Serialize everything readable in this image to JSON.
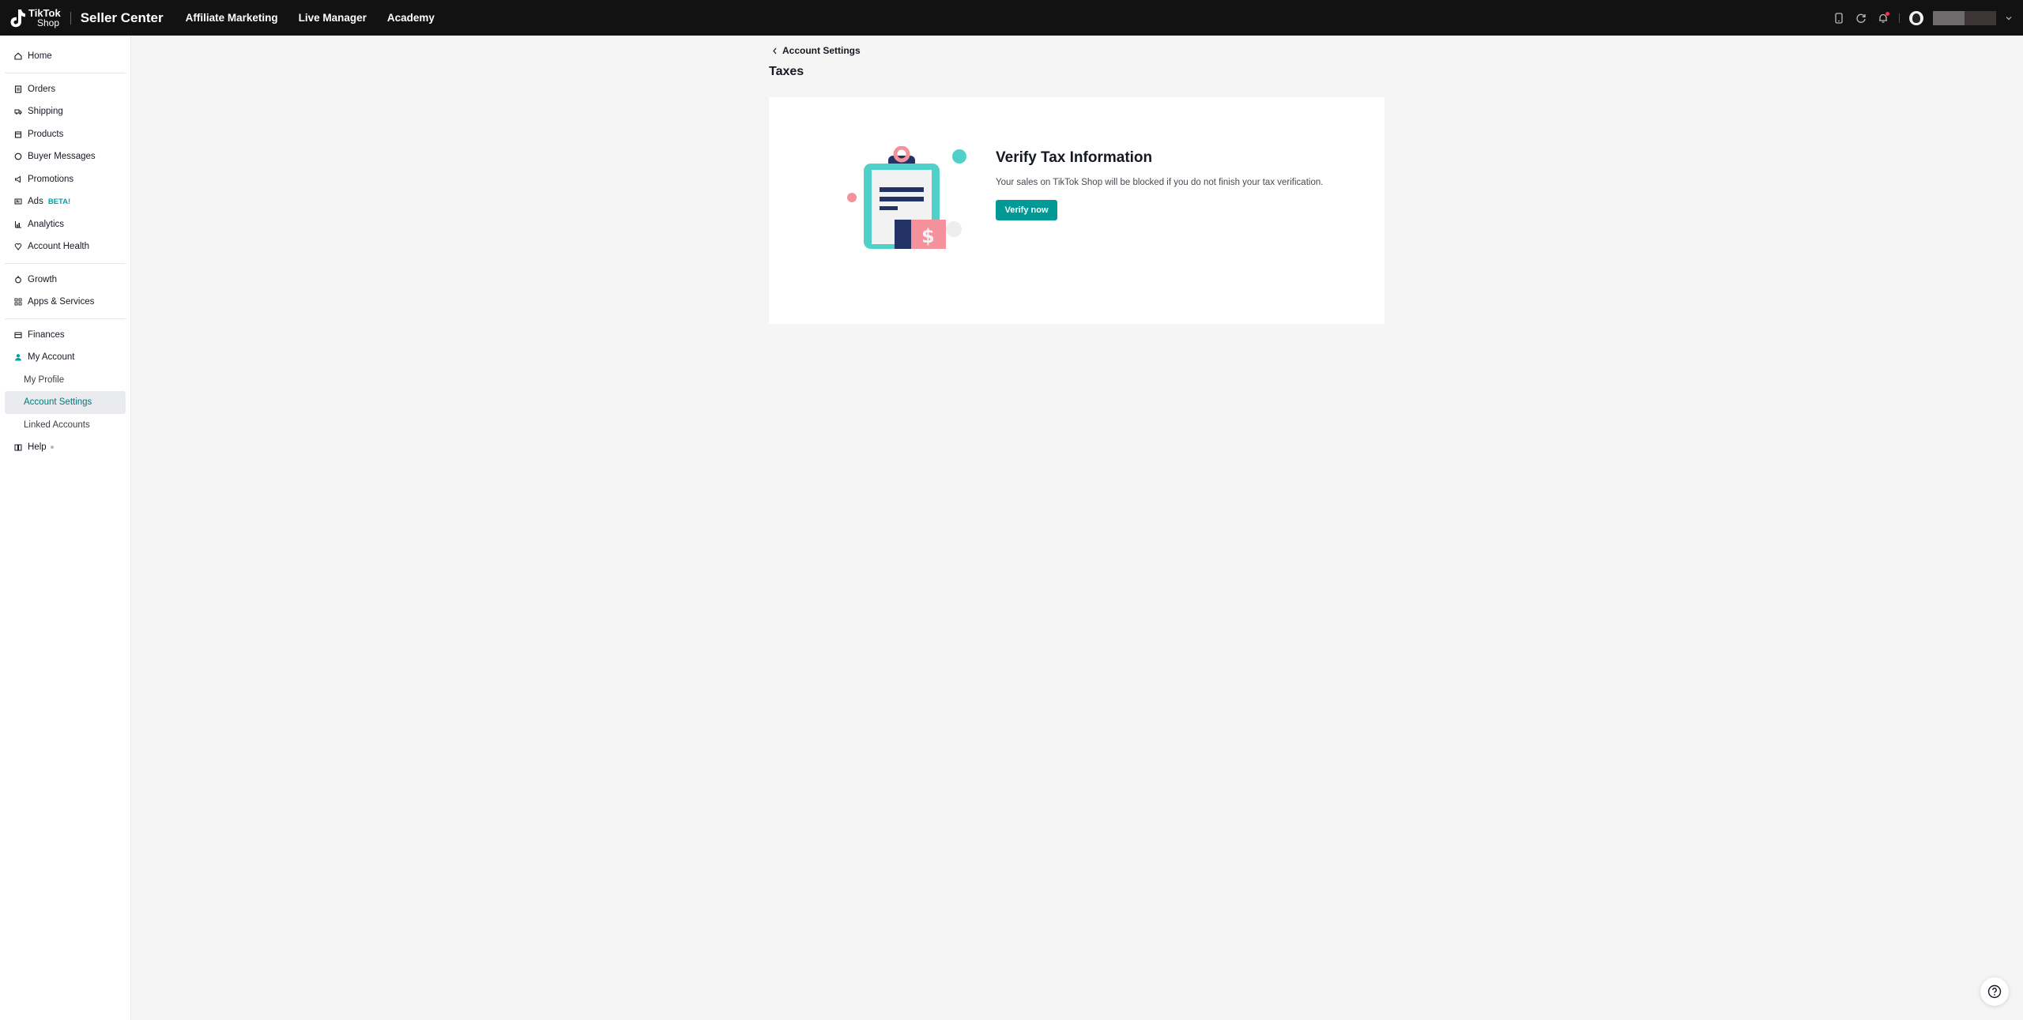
{
  "topbar": {
    "brand_line1": "TikTok",
    "brand_line2": "Shop",
    "title": "Seller Center",
    "nav": [
      "Affiliate Marketing",
      "Live Manager",
      "Academy"
    ]
  },
  "sidebar": {
    "items": [
      {
        "label": "Home",
        "icon": "home-icon"
      },
      {
        "label": "Orders",
        "icon": "orders-icon"
      },
      {
        "label": "Shipping",
        "icon": "shipping-icon"
      },
      {
        "label": "Products",
        "icon": "products-icon"
      },
      {
        "label": "Buyer Messages",
        "icon": "message-icon"
      },
      {
        "label": "Promotions",
        "icon": "megaphone-icon"
      },
      {
        "label": "Ads",
        "icon": "ads-icon",
        "badge": "BETA!"
      },
      {
        "label": "Analytics",
        "icon": "analytics-icon"
      },
      {
        "label": "Account Health",
        "icon": "health-icon"
      },
      {
        "label": "Growth",
        "icon": "growth-icon"
      },
      {
        "label": "Apps & Services",
        "icon": "apps-icon"
      },
      {
        "label": "Finances",
        "icon": "finances-icon"
      },
      {
        "label": "My Account",
        "icon": "user-icon"
      },
      {
        "label": "My Profile"
      },
      {
        "label": "Account Settings"
      },
      {
        "label": "Linked Accounts"
      },
      {
        "label": "Help",
        "icon": "help-book-icon"
      }
    ]
  },
  "main": {
    "breadcrumb": "Account Settings",
    "page_title": "Taxes",
    "card": {
      "title": "Verify Tax Information",
      "description": "Your sales on TikTok Shop will be blocked if you do not finish your tax verification.",
      "button": "Verify now"
    }
  },
  "colors": {
    "accent": "#009995",
    "topbar": "#121212",
    "active_text": "#00777a",
    "illus_teal": "#4fd1c9",
    "illus_pink": "#f5919b",
    "illus_navy": "#233366"
  }
}
